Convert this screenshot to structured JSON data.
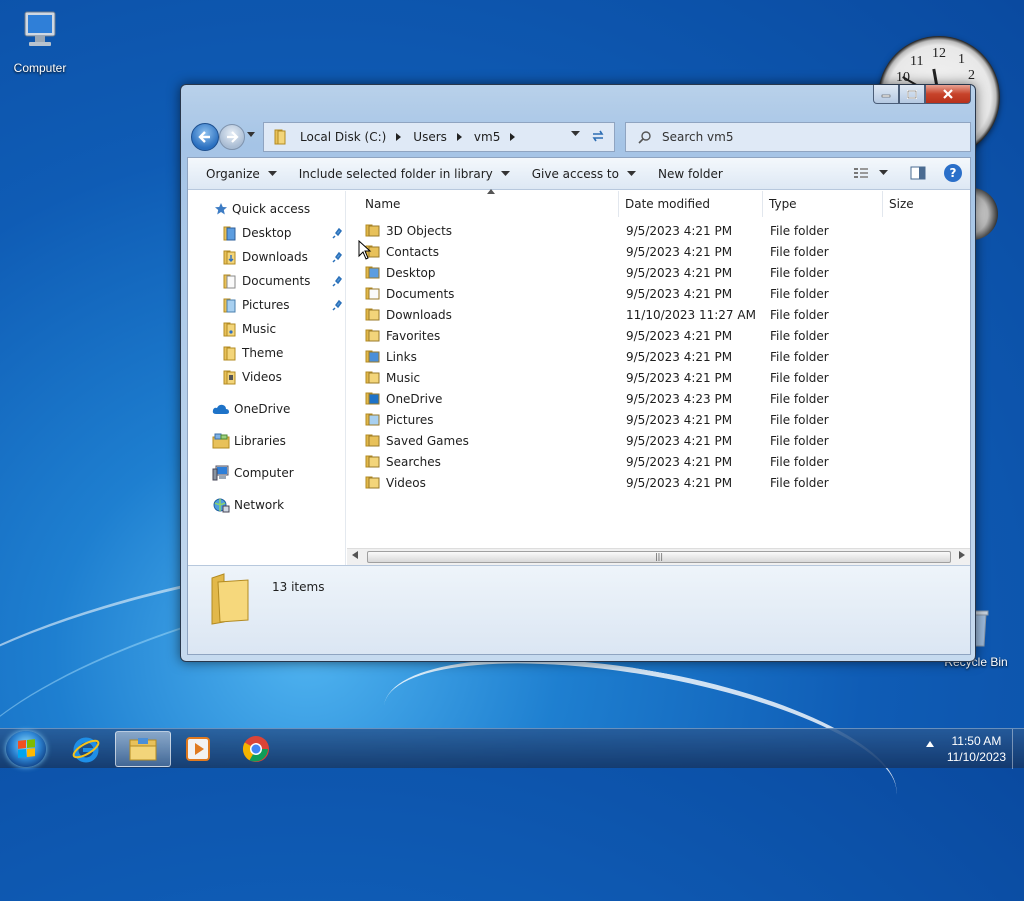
{
  "desktop": {
    "icons": [
      {
        "label": "Computer"
      },
      {
        "label": "Recycle Bin"
      }
    ]
  },
  "window": {
    "address": {
      "crumbs": [
        "Local Disk (C:)",
        "Users",
        "vm5"
      ]
    },
    "search": {
      "placeholder": "Search vm5"
    },
    "toolbar": {
      "organize": "Organize",
      "include": "Include selected folder in library",
      "give_access": "Give access to",
      "new_folder": "New folder",
      "help": "?"
    },
    "nav": {
      "quick_access": "Quick access",
      "quick_items": [
        "Desktop",
        "Downloads",
        "Documents",
        "Pictures",
        "Music",
        "Theme",
        "Videos"
      ],
      "onedrive": "OneDrive",
      "libraries": "Libraries",
      "computer": "Computer",
      "network": "Network"
    },
    "columns": [
      "Name",
      "Date modified",
      "Type",
      "Size"
    ],
    "rows": [
      {
        "name": "3D Objects",
        "date": "9/5/2023 4:21 PM",
        "type": "File folder"
      },
      {
        "name": "Contacts",
        "date": "9/5/2023 4:21 PM",
        "type": "File folder"
      },
      {
        "name": "Desktop",
        "date": "9/5/2023 4:21 PM",
        "type": "File folder"
      },
      {
        "name": "Documents",
        "date": "9/5/2023 4:21 PM",
        "type": "File folder"
      },
      {
        "name": "Downloads",
        "date": "11/10/2023 11:27 AM",
        "type": "File folder"
      },
      {
        "name": "Favorites",
        "date": "9/5/2023 4:21 PM",
        "type": "File folder"
      },
      {
        "name": "Links",
        "date": "9/5/2023 4:21 PM",
        "type": "File folder"
      },
      {
        "name": "Music",
        "date": "9/5/2023 4:21 PM",
        "type": "File folder"
      },
      {
        "name": "OneDrive",
        "date": "9/5/2023 4:23 PM",
        "type": "File folder"
      },
      {
        "name": "Pictures",
        "date": "9/5/2023 4:21 PM",
        "type": "File folder"
      },
      {
        "name": "Saved Games",
        "date": "9/5/2023 4:21 PM",
        "type": "File folder"
      },
      {
        "name": "Searches",
        "date": "9/5/2023 4:21 PM",
        "type": "File folder"
      },
      {
        "name": "Videos",
        "date": "9/5/2023 4:21 PM",
        "type": "File folder"
      }
    ],
    "status": {
      "count": "13 items"
    }
  },
  "clock_gadget": {
    "numbers": [
      "11",
      "12",
      "1",
      "2",
      "10"
    ]
  },
  "taskbar": {
    "time": "11:50 AM",
    "date": "11/10/2023",
    "apps": [
      "ie-icon",
      "file-explorer-icon",
      "media-player-icon",
      "chrome-icon"
    ]
  },
  "colors": {
    "accent": "#2a6fc9",
    "folder": "#e8c15a",
    "close": "#c7432a"
  }
}
